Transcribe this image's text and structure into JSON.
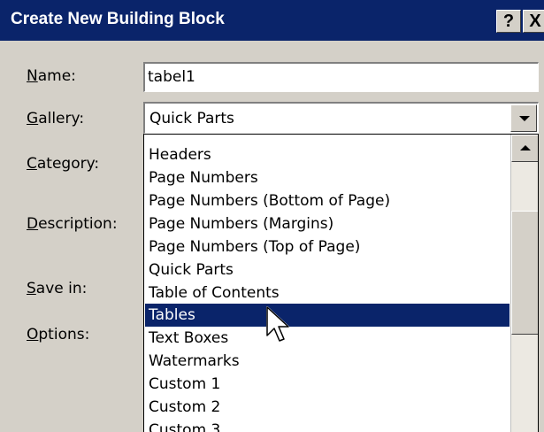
{
  "dialog": {
    "title": "Create New Building Block",
    "help_button": "?",
    "close_button": "X"
  },
  "fields": {
    "name": {
      "access_key": "N",
      "rest": "ame:",
      "value": "tabel1"
    },
    "gallery": {
      "access_key": "G",
      "rest": "allery:",
      "value": "Quick Parts"
    },
    "category": {
      "access_key": "C",
      "rest": "ategory:"
    },
    "description": {
      "access_key": "D",
      "rest": "escription:"
    },
    "save_in": {
      "access_key": "S",
      "rest": "ave in:"
    },
    "options": {
      "access_key": "O",
      "rest": "ptions:"
    }
  },
  "gallery_dropdown": {
    "items": [
      "Headers",
      "Page Numbers",
      "Page Numbers (Bottom of Page)",
      "Page Numbers (Margins)",
      "Page Numbers (Top of Page)",
      "Quick Parts",
      "Table of Contents",
      "Tables",
      "Text Boxes",
      "Watermarks",
      "Custom 1",
      "Custom 2",
      "Custom 3"
    ],
    "highlighted": "Tables"
  },
  "icons": {
    "combo_arrow": "chevron-down-icon",
    "scroll_up": "scroll-up-icon",
    "pointer": "mouse-pointer-icon"
  },
  "colors": {
    "titlebar": "#0a246a",
    "selection": "#0a246a",
    "dialog_bg": "#d4d0c8"
  }
}
